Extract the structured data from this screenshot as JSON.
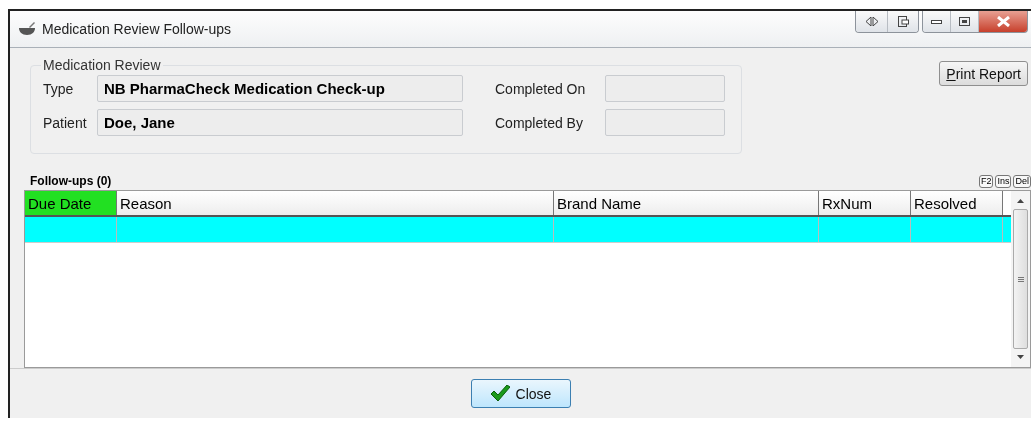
{
  "window": {
    "title": "Medication Review Follow-ups"
  },
  "review": {
    "legend": "Medication Review",
    "fields": [
      {
        "label": "Type",
        "value": "NB PharmaCheck Medication Check-up"
      },
      {
        "label": "Patient",
        "value": "Doe, Jane"
      }
    ],
    "completion": [
      {
        "label": "Completed On"
      },
      {
        "label": "Completed By"
      }
    ]
  },
  "print_button": "Print Report",
  "followups": {
    "title": "Follow-ups (0)",
    "keys": [
      "F2",
      "Ins",
      "Del"
    ],
    "columns": [
      {
        "label": "Due Date",
        "selected": true
      },
      {
        "label": "Reason",
        "selected": false
      },
      {
        "label": "Brand Name",
        "selected": false
      },
      {
        "label": "RxNum",
        "selected": false
      },
      {
        "label": "Resolved",
        "selected": false
      }
    ],
    "rows": [
      {
        "selected": true
      }
    ]
  },
  "close_button": "Close"
}
